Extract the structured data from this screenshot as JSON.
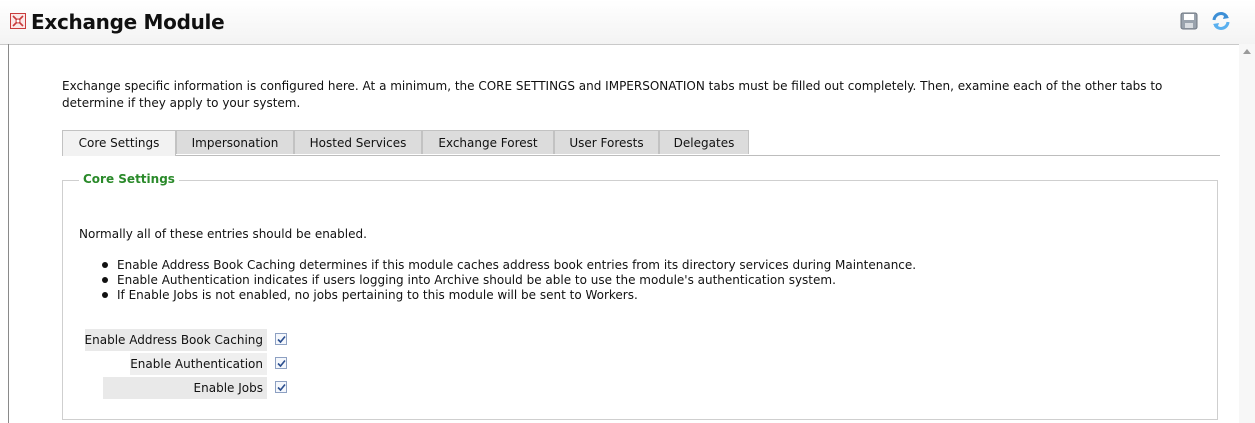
{
  "header": {
    "title": "Exchange Module",
    "icons": {
      "module": "module-icon",
      "save": "save-icon",
      "refresh": "refresh-icon"
    }
  },
  "intro": "Exchange specific information is configured here. At a minimum, the CORE SETTINGS and IMPERSONATION tabs must be filled out completely. Then, examine each of the other tabs to determine if they apply to your system.",
  "tabs": [
    {
      "label": "Core Settings",
      "active": true
    },
    {
      "label": "Impersonation"
    },
    {
      "label": "Hosted Services"
    },
    {
      "label": "Exchange Forest"
    },
    {
      "label": "User Forests"
    },
    {
      "label": "Delegates"
    }
  ],
  "core": {
    "legend": "Core Settings",
    "description": "Normally all of these entries should be enabled.",
    "bullets": [
      "Enable Address Book Caching determines if this module caches address book entries from its directory services during Maintenance.",
      "Enable Authentication indicates if users logging into Archive should be able to use the module's authentication system.",
      "If Enable Jobs is not enabled, no jobs pertaining to this module will be sent to Workers."
    ],
    "options": [
      {
        "label": "Enable Address Book Caching",
        "checked": true
      },
      {
        "label": "Enable Authentication",
        "checked": true
      },
      {
        "label": "Enable Jobs",
        "checked": true
      }
    ]
  },
  "colors": {
    "legend": "#2a8a2a",
    "checkbox_border": "#8da0c2",
    "check": "#2c4f8f"
  }
}
